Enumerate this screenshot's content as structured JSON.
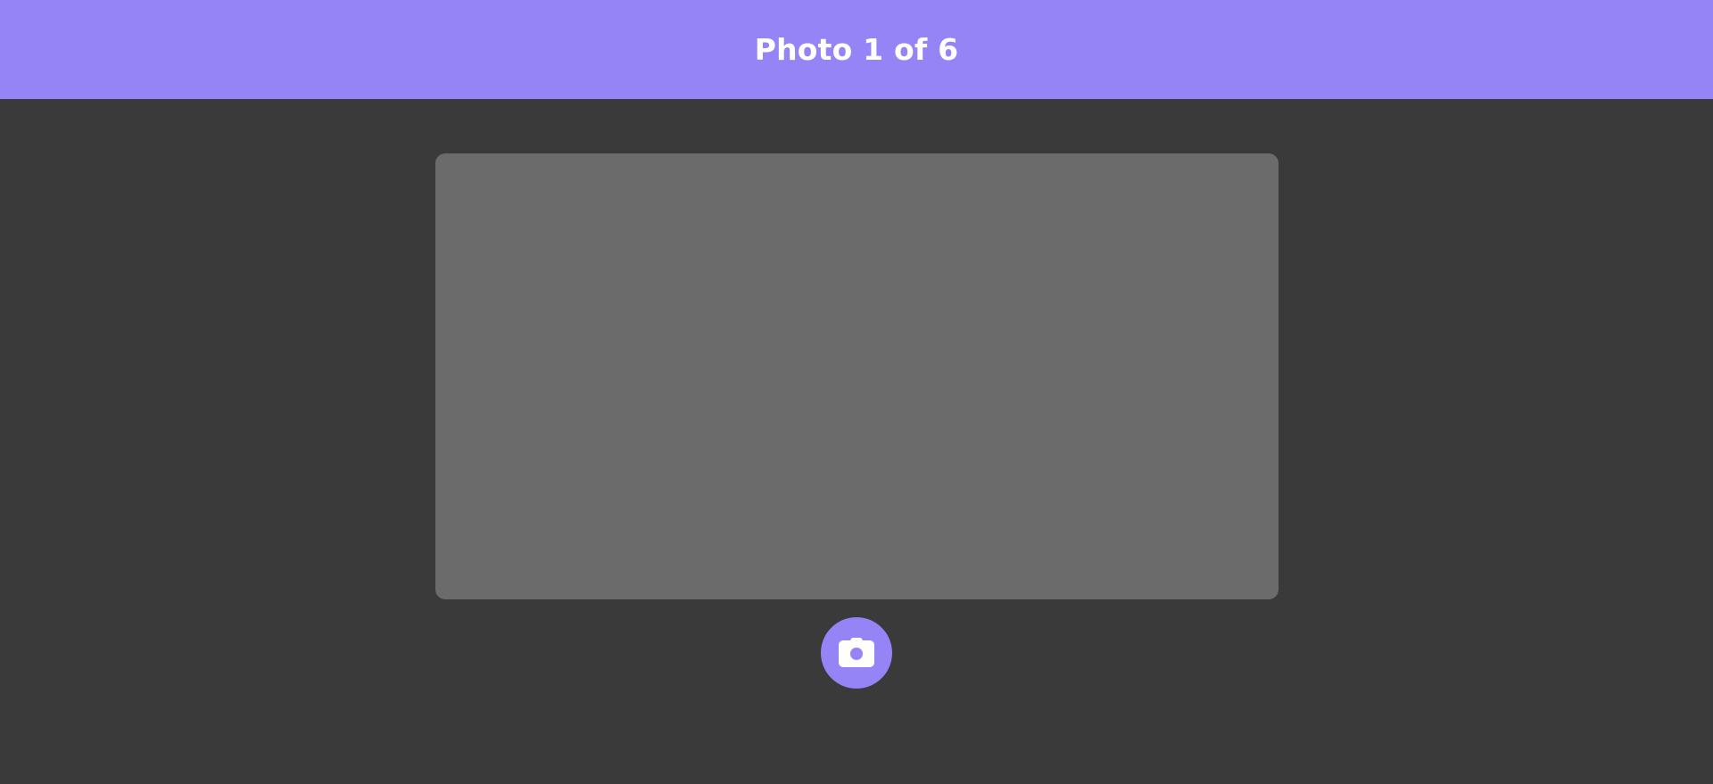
{
  "header": {
    "title": "Photo 1 of 6"
  },
  "camera": {
    "capture_button_icon": "camera-icon"
  },
  "colors": {
    "accent": "#9584f6",
    "background": "#3a3a3a",
    "viewfinder": "#6b6b6b",
    "header_text": "#ffffff"
  }
}
